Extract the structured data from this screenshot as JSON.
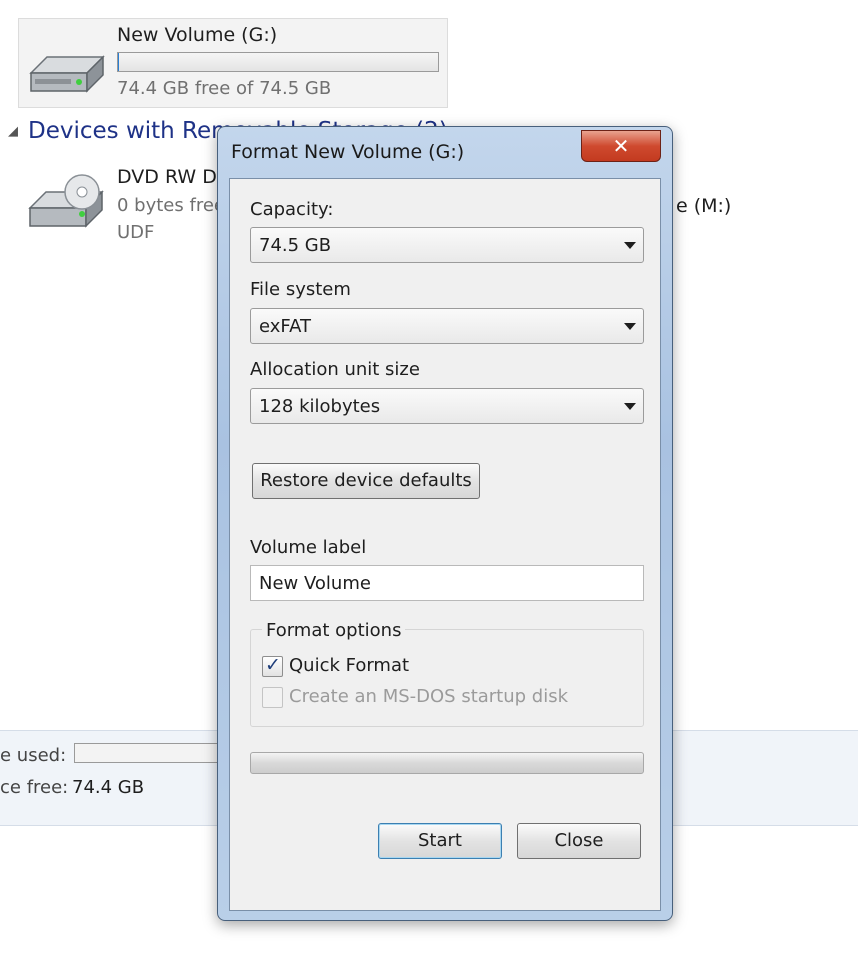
{
  "explorer": {
    "drive_g": {
      "name": "New Volume (G:)",
      "space": "74.4 GB free of 74.5 GB",
      "used_fraction": 0.0013
    },
    "section_devices": "Devices with Removable Storage (2)",
    "dvd": {
      "name": "DVD RW Drive (F:)",
      "space": "0 bytes free of 0 bytes",
      "fs": "UDF"
    },
    "other_drive_suffix": "e (M:)",
    "details": {
      "space_used_label": "e used:",
      "space_free_label": "ce free:",
      "space_free_value": "74.4 GB"
    }
  },
  "dialog": {
    "title": "Format New Volume (G:)",
    "close_glyph": "✕",
    "capacity_label": "Capacity:",
    "capacity_value": "74.5 GB",
    "filesystem_label": "File system",
    "filesystem_value": "exFAT",
    "allocation_label": "Allocation unit size",
    "allocation_value": "128 kilobytes",
    "restore_button": "Restore device defaults",
    "volume_label_label": "Volume label",
    "volume_label_value": "New Volume",
    "format_options_label": "Format options",
    "quick_format_label": "Quick Format",
    "quick_format_checked": true,
    "msdos_label": "Create an MS-DOS startup disk",
    "msdos_checked": false,
    "progress_fraction": 0,
    "start_button": "Start",
    "close_button": "Close"
  }
}
